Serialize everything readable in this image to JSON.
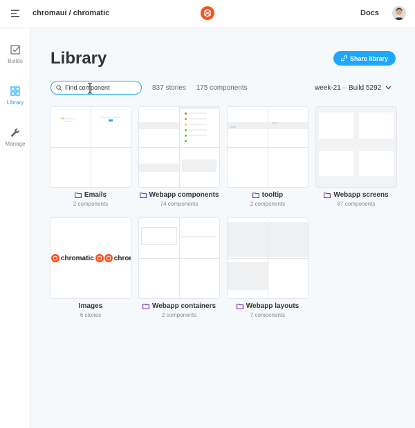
{
  "header": {
    "repo": "chromaui / chromatic",
    "docs_label": "Docs"
  },
  "sidebar": {
    "items": [
      {
        "label": "Builds",
        "icon": "checkbox-icon",
        "active": false
      },
      {
        "label": "Library",
        "icon": "grid-icon",
        "active": true
      },
      {
        "label": "Manage",
        "icon": "wrench-icon",
        "active": false
      }
    ]
  },
  "page": {
    "title": "Library",
    "share_label": "Share library",
    "search_value": "Find component",
    "stories_count": "837 stories",
    "components_count": "175 components",
    "branch": "week-21",
    "build_separator": "–",
    "build": "Build 5292"
  },
  "cards": [
    {
      "name": "Emails",
      "sub": "2 components",
      "folder": true
    },
    {
      "name": "Webapp components",
      "sub": "74 components",
      "folder": true
    },
    {
      "name": "tooltip",
      "sub": "2 components",
      "folder": true
    },
    {
      "name": "Webapp screens",
      "sub": "87 components",
      "folder": true
    },
    {
      "name": "Images",
      "sub": "6 stories",
      "folder": false,
      "thumb_text_1": "chromatic",
      "thumb_text_2": "chroma"
    },
    {
      "name": "Webapp containers",
      "sub": "2 components",
      "folder": true
    },
    {
      "name": "Webapp layouts",
      "sub": "7 components",
      "folder": true
    }
  ],
  "colors": {
    "accent": "#1ea7fd",
    "folder": "#6f2cac",
    "brand": "#fc521f"
  }
}
